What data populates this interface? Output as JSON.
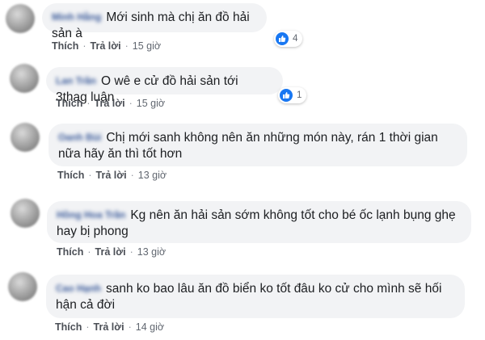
{
  "actions": {
    "like": "Thích",
    "reply": "Trả lời"
  },
  "comments": [
    {
      "author": "Minh Hằng",
      "text": "Mới sinh mà chị ăn đồ hải sản à",
      "time": "15 giờ",
      "reactions": "4"
    },
    {
      "author": "Lan Trần",
      "text": "O wê e cử đồ hải sản tới 3thag luận",
      "time": "15 giờ",
      "reactions": "1"
    },
    {
      "author": "Oanh Bùi",
      "text": "Chị mới sanh không nên ăn những món này, rán 1 thời gian nữa hãy ăn thì tốt hơn",
      "time": "13 giờ"
    },
    {
      "author": "Hồng Hoa Trần",
      "text": "Kg nên ăn hải sản sớm không tốt cho bé ốc lạnh bụng ghẹ hay bị phong",
      "time": "13 giờ"
    },
    {
      "author": "Cao Hạnh",
      "text": "sanh ko bao lâu ăn đồ biển ko tốt đâu ko cử cho mình sẽ hối hận cả đời",
      "time": "14 giờ"
    }
  ],
  "colors": {
    "like_blue": "#1877f2",
    "author_blue": "#385898"
  }
}
